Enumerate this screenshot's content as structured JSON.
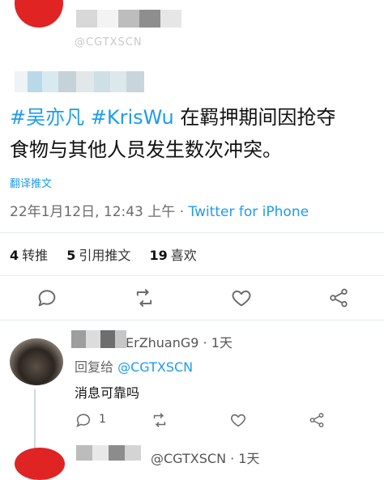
{
  "tweet": {
    "faded_handle": "@CGTXSCN",
    "hashtag1": "#吴亦凡",
    "hashtag2": "#KrisWu",
    "text_line1_rest": " 在羁押期间因抢夺",
    "text_line2": "食物与其他人员发生数次冲突。",
    "translate_label": "翻译推文",
    "timestamp": "22年1月12日, 12:43 上午",
    "dot": "·",
    "source": "Twitter for iPhone",
    "stats": {
      "retweets_count": "4",
      "retweets_label": "转推",
      "quotes_count": "5",
      "quotes_label": "引用推文",
      "likes_count": "19",
      "likes_label": "喜欢"
    },
    "icons": [
      "reply-icon",
      "retweet-icon",
      "like-icon",
      "share-icon"
    ]
  },
  "reply": {
    "name_visible": "ErZhuanG9 · 1天",
    "replying_prefix": "回复给 ",
    "mention": "@CGTXSCN",
    "text": "消息可靠吗",
    "reply_count": "1"
  },
  "next_tweet": {
    "handle_visible": "@CGTXSCN · 1天"
  },
  "colors": {
    "accent": "#1d9bf0",
    "avatar_red": "#e02323",
    "muted": "#6b6b6b"
  }
}
